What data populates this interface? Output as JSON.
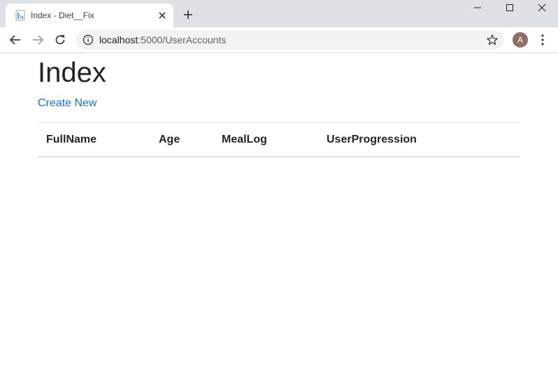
{
  "browser": {
    "tab_title": "Index - Diet__Fix",
    "url_host": "localhost",
    "url_rest": ":5000/UserAccounts",
    "avatar_letter": "A"
  },
  "page": {
    "title": "Index",
    "create_link": "Create New"
  },
  "table": {
    "headers": [
      "FullName",
      "Age",
      "MealLog",
      "UserProgression"
    ],
    "rows": []
  },
  "colors": {
    "link": "#1a6fc9",
    "tabstrip": "#dee1e6",
    "avatar": "#8d6e63"
  }
}
